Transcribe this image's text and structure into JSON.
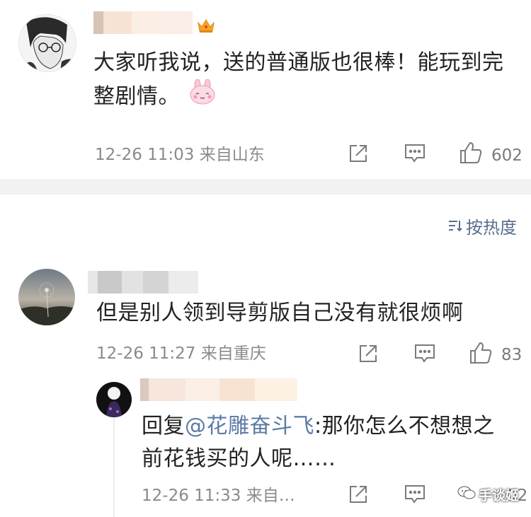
{
  "comment1": {
    "crown_icon": "crown-icon",
    "text_line1": "大家听我说，送的普通版也很棒！能玩到完",
    "text_line2": "整剧情。",
    "emoji_icon": "bunny-emoji-icon",
    "meta": "12-26 11:03 来自山东",
    "like_count": "602"
  },
  "sort": {
    "label": "按热度",
    "icon": "sort-icon"
  },
  "comment2": {
    "text": "但是别人领到导剪版自己没有就很烦啊",
    "meta": "12-26 11:27 来自重庆",
    "like_count": "83"
  },
  "reply": {
    "prefix": "回复",
    "mention": "@花雕奋斗飞",
    "text_line1_rest": ":那你怎么不想想之",
    "text_line2": "前花钱买的人呢……",
    "meta": "12-26 11:33 来自…",
    "like_count": "52"
  },
  "watermark": {
    "text": "手谈姬"
  },
  "colors": {
    "link": "#5b7ba6",
    "meta": "#8a8a8a",
    "divider": "#f2f2f2"
  }
}
